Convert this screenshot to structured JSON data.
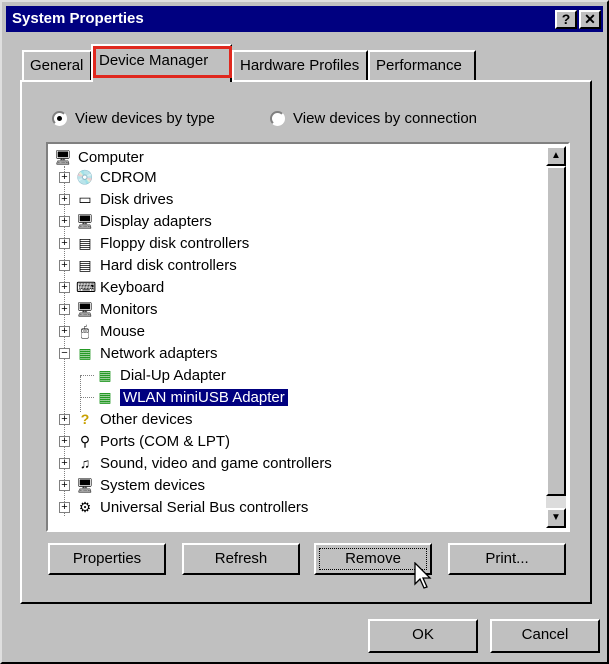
{
  "window": {
    "title": "System Properties",
    "help_label": "?",
    "close_label": "✕"
  },
  "tabs": [
    {
      "label": "General"
    },
    {
      "label": "Device Manager"
    },
    {
      "label": "Hardware Profiles"
    },
    {
      "label": "Performance"
    }
  ],
  "view": {
    "by_type": "View devices by type",
    "by_connection": "View devices by connection",
    "selected": "by_type"
  },
  "tree": {
    "root": "Computer",
    "items": [
      {
        "label": "CDROM",
        "icon": "cdrom-icon"
      },
      {
        "label": "Disk drives",
        "icon": "disk-icon"
      },
      {
        "label": "Display adapters",
        "icon": "display-icon"
      },
      {
        "label": "Floppy disk controllers",
        "icon": "floppy-icon"
      },
      {
        "label": "Hard disk controllers",
        "icon": "harddisk-icon"
      },
      {
        "label": "Keyboard",
        "icon": "keyboard-icon"
      },
      {
        "label": "Monitors",
        "icon": "monitor-icon"
      },
      {
        "label": "Mouse",
        "icon": "mouse-icon"
      },
      {
        "label": "Network adapters",
        "icon": "network-icon"
      },
      {
        "label": "Dial-Up Adapter",
        "icon": "network-icon"
      },
      {
        "label": "WLAN miniUSB Adapter",
        "icon": "network-icon"
      },
      {
        "label": "Other devices",
        "icon": "question-icon"
      },
      {
        "label": "Ports (COM & LPT)",
        "icon": "port-icon"
      },
      {
        "label": "Sound, video and game controllers",
        "icon": "sound-icon"
      },
      {
        "label": "System devices",
        "icon": "system-icon"
      },
      {
        "label": "Universal Serial Bus controllers",
        "icon": "usb-icon"
      }
    ],
    "selected": "WLAN miniUSB Adapter"
  },
  "buttons": {
    "properties": "Properties",
    "refresh": "Refresh",
    "remove": "Remove",
    "print": "Print...",
    "ok": "OK",
    "cancel": "Cancel"
  },
  "colors": {
    "selection": "#000080",
    "highlight_box": "#e0281e"
  }
}
